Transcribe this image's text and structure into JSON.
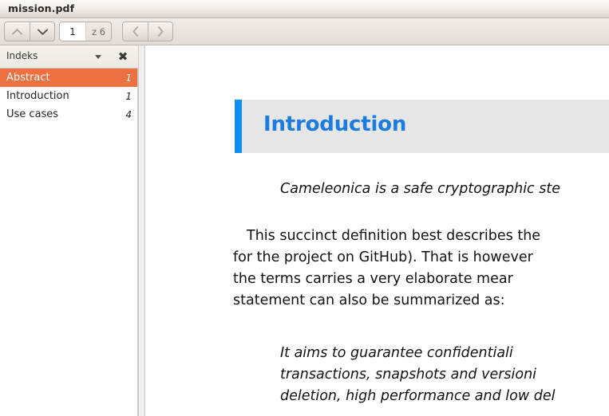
{
  "window": {
    "title": "mission.pdf"
  },
  "toolbar": {
    "prev_page_icon": "chevron-up-icon",
    "next_page_icon": "chevron-down-icon",
    "back_icon": "chevron-left-icon",
    "forward_icon": "chevron-right-icon",
    "page_current": "1",
    "page_total": "z 6",
    "page_input_placeholder": "1"
  },
  "sidebar": {
    "header_label": "Indeks",
    "caret_icon": "chevron-down-icon",
    "close_icon": "close-icon",
    "close_glyph": "✖",
    "items": [
      {
        "label": "Abstract",
        "page": "1",
        "selected": true
      },
      {
        "label": "Introduction",
        "page": "1",
        "selected": false
      },
      {
        "label": "Use cases",
        "page": "4",
        "selected": false
      }
    ]
  },
  "document": {
    "heading": "Introduction",
    "lead_italic": "Cameleonica is a safe cryptographic ste",
    "body_lines": [
      "This succinct definition best describes the",
      "for the project on GitHub). That is however",
      "the  terms  carries  a  very  elaborate  mear",
      "statement can also be summarized as:"
    ],
    "quote_lines": [
      "It    aims    to    guarantee    confidentiali",
      "transactions,   snapshots   and   versioni",
      "deletion, high performance and low del"
    ]
  },
  "colors": {
    "selection_orange": "#ec7040",
    "heading_blue": "#1a7be0",
    "accent_bar_blue": "#0d90f2",
    "heading_band_gray": "#e6e6e6",
    "titlebar_beige": "#eae4df"
  }
}
